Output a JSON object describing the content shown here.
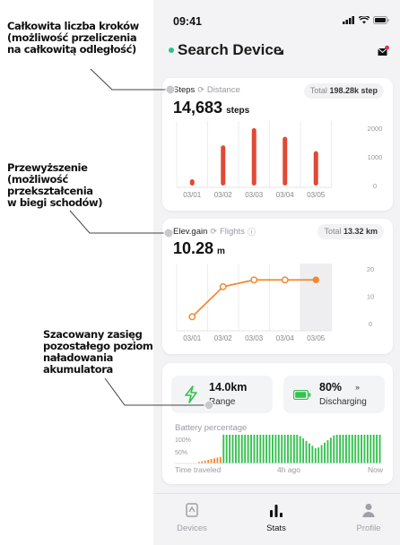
{
  "annotations": {
    "steps_note": [
      "Całkowita liczba kroków",
      "(możliwość przeliczenia",
      "na całkowitą odległość)"
    ],
    "elevation_note": [
      "Przewyższenie",
      "(możliwość",
      "przekształcenia",
      "w biegi schodów)"
    ],
    "range_note": [
      "Szacowany zasięg",
      "pozostałego poziomu",
      "naładowania",
      "akumulatora"
    ]
  },
  "status_bar": {
    "time": "09:41"
  },
  "header": {
    "title": "Search Device"
  },
  "steps_card": {
    "primary_label": "Steps",
    "secondary_label": "Distance",
    "total_label": "Total",
    "total_value": "198.28k step",
    "value": "14,683",
    "unit": "steps"
  },
  "elev_card": {
    "primary_label": "Elev.gain",
    "secondary_label": "Flights",
    "total_label": "Total",
    "total_value": "13.32 km",
    "value": "10.28",
    "unit": "m"
  },
  "battery_card": {
    "range_value": "14.0km",
    "range_label": "Range",
    "battery_value": "80%",
    "battery_arrow": "»",
    "battery_label": "Discharging",
    "title": "Battery percentage",
    "axis_100": "100%",
    "axis_50": "50%",
    "time_label": "Time traveled",
    "time_mid": "4h ago",
    "time_end": "Now"
  },
  "tabs": [
    {
      "label": "Devices"
    },
    {
      "label": "Stats"
    },
    {
      "label": "Profile"
    }
  ],
  "colors": {
    "accent_red": "#e04a35",
    "accent_orange": "#f4892f",
    "battery_green": "#35c04f",
    "status_green": "#2ec08a"
  },
  "chart_data": [
    {
      "type": "bar",
      "categories": [
        "03/01",
        "03/02",
        "03/03",
        "03/04",
        "03/05"
      ],
      "values": [
        220,
        1400,
        2000,
        1700,
        1200
      ],
      "y_ticks": [
        0,
        1000,
        2000
      ],
      "ylim": [
        0,
        2250
      ]
    },
    {
      "type": "line",
      "categories": [
        "03/01",
        "03/02",
        "03/03",
        "03/04",
        "03/05"
      ],
      "values": [
        2.5,
        13.5,
        16,
        16,
        16
      ],
      "y_ticks": [
        0,
        10,
        20
      ],
      "ylim": [
        0,
        22
      ]
    }
  ]
}
